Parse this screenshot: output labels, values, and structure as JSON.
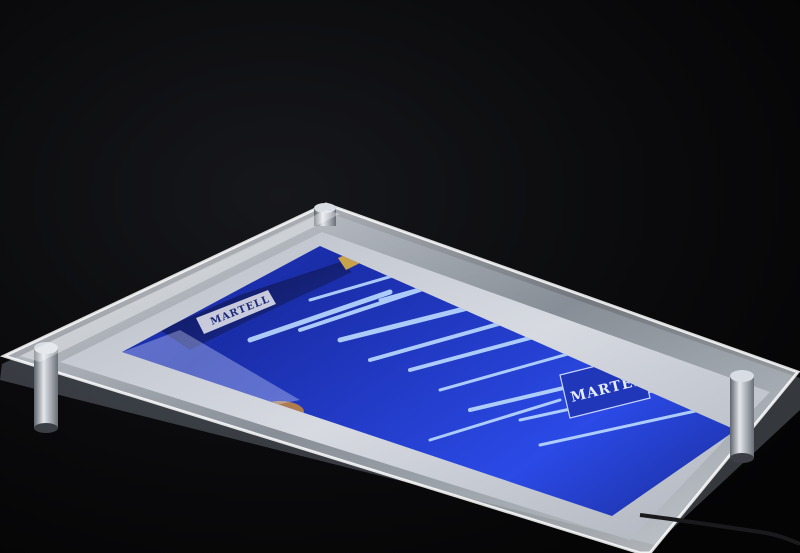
{
  "photo": {
    "subject": "acrylic-led-light-box",
    "poster": {
      "brand_label": "MARTELL",
      "bottle_label": "MARTELL"
    },
    "colors": {
      "background": "#050506",
      "acrylic_edge": "#dfe6ee",
      "mat": "#c9ccd4",
      "poster_blue": "#1f36c8",
      "light_streak": "#b9d8ff",
      "standoff_metal": "#9aa0a8"
    }
  }
}
